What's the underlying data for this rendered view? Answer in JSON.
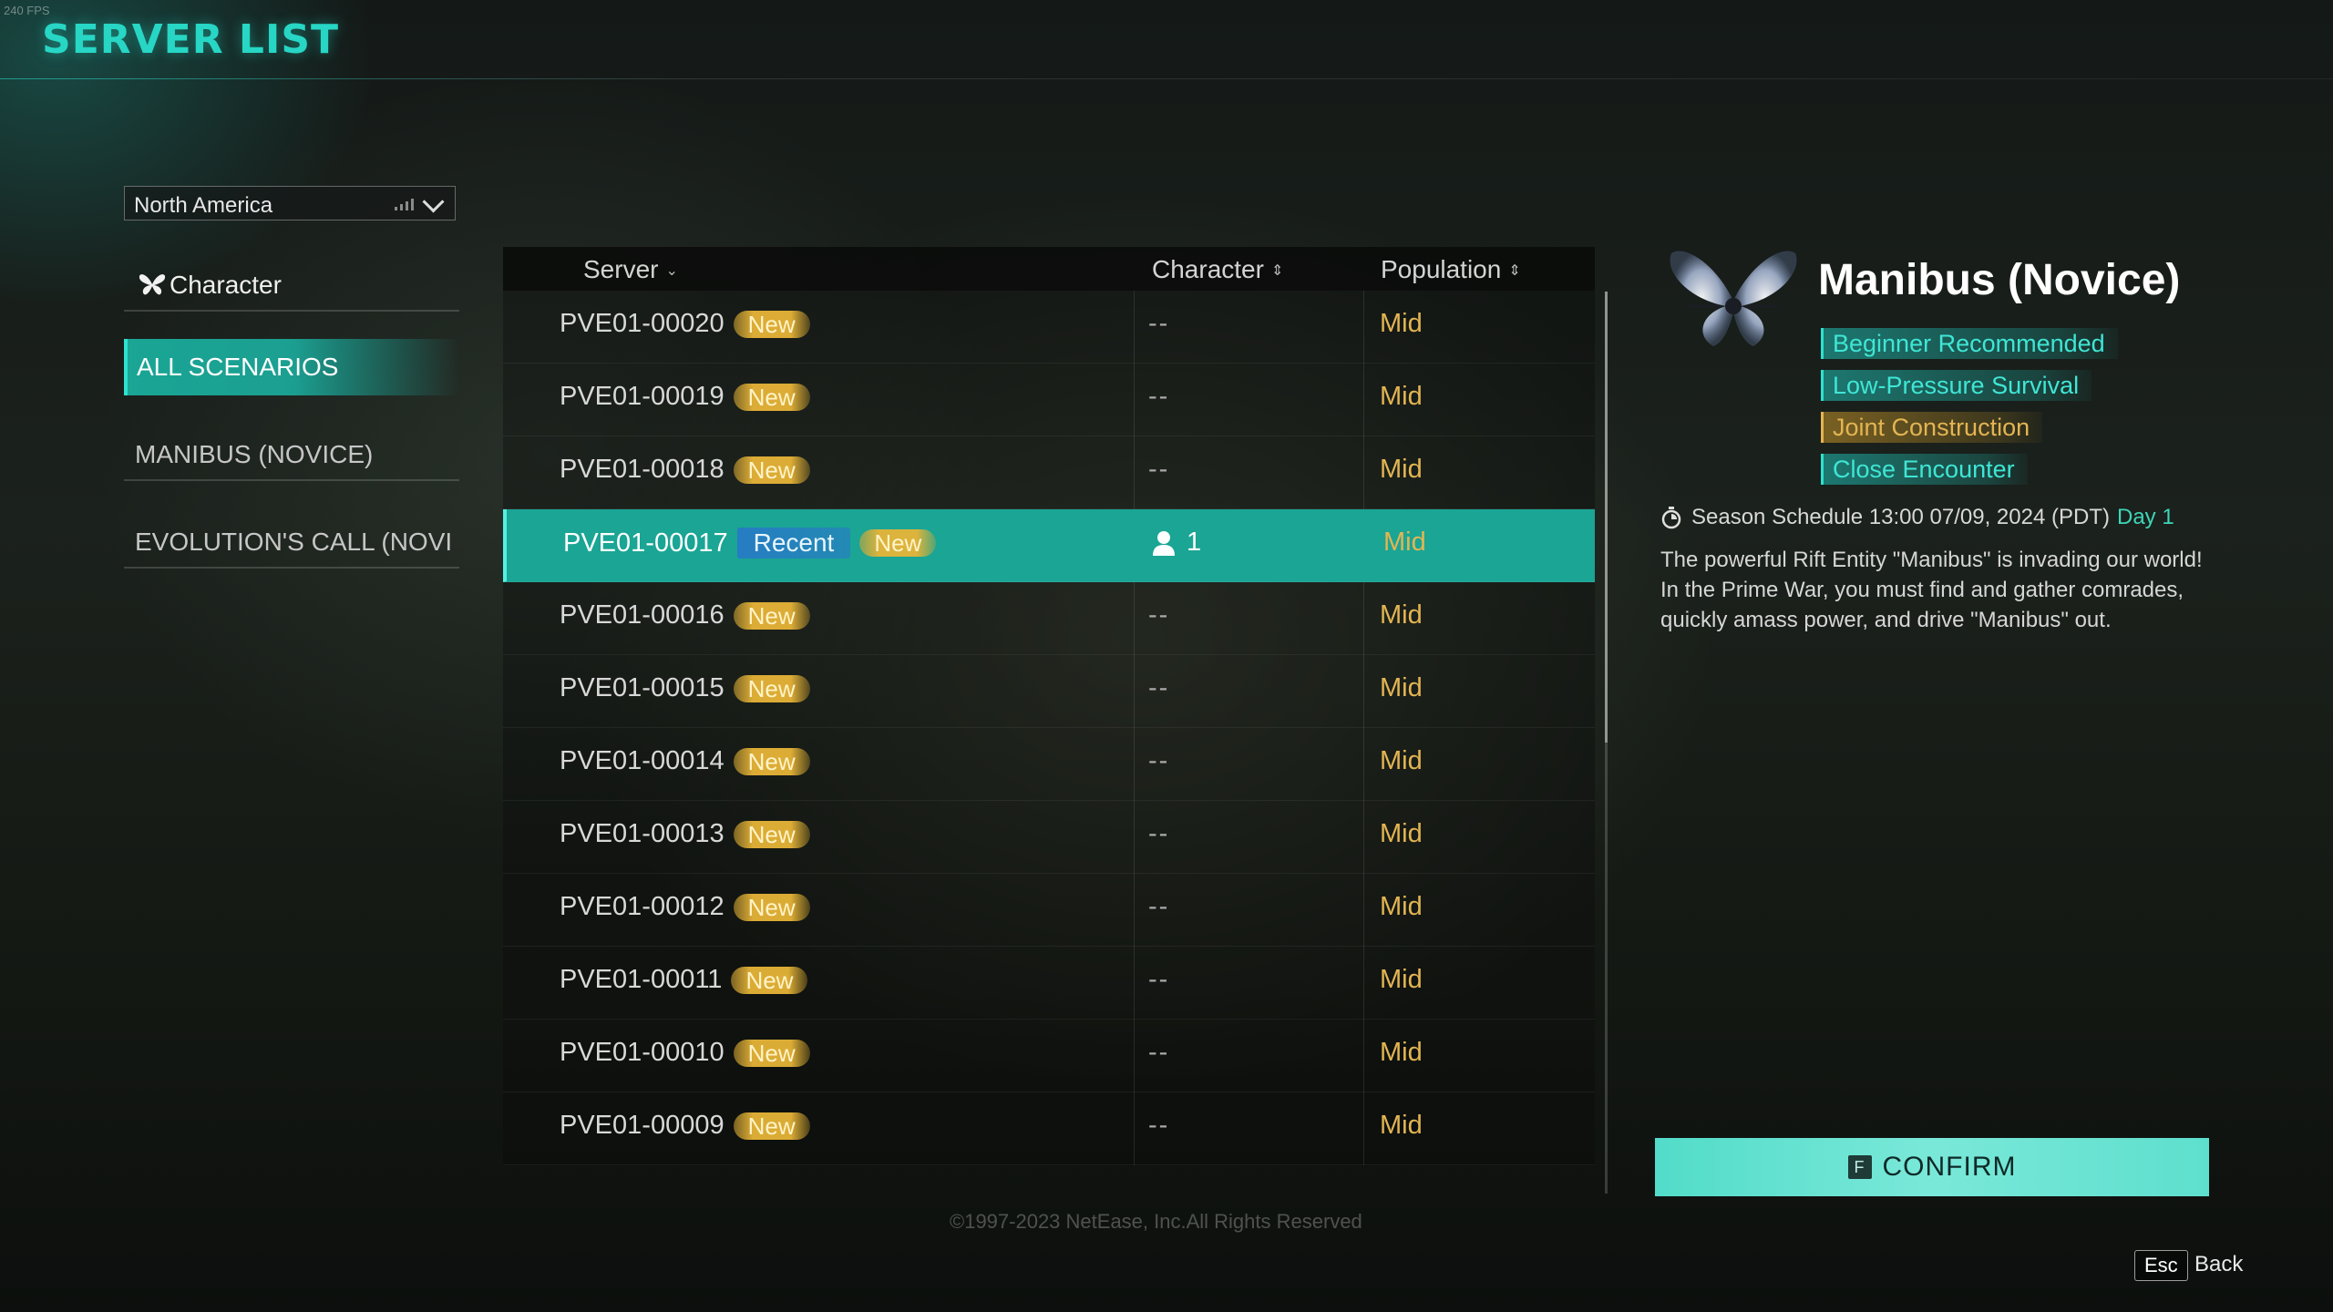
{
  "overlay": {
    "fps": "240 FPS"
  },
  "header": {
    "title": "SERVER LIST"
  },
  "region": {
    "selected": "North America",
    "signal_icon": "signal-bars-icon",
    "dropdown_icon": "chevron-down-icon"
  },
  "nav": {
    "character": {
      "label": "Character",
      "icon": "butterfly-icon"
    },
    "items": [
      {
        "label": "ALL SCENARIOS",
        "active": true
      },
      {
        "label": "MANIBUS (NOVICE)",
        "active": false
      },
      {
        "label": "EVOLUTION'S CALL (NOVI",
        "active": false
      }
    ]
  },
  "table": {
    "columns": [
      "Server",
      "Character",
      "Population"
    ],
    "rows": [
      {
        "server": "PVE01-00020",
        "badges": [
          "New"
        ],
        "character": "--",
        "population": "Mid"
      },
      {
        "server": "PVE01-00019",
        "badges": [
          "New"
        ],
        "character": "--",
        "population": "Mid"
      },
      {
        "server": "PVE01-00018",
        "badges": [
          "New"
        ],
        "character": "--",
        "population": "Mid"
      },
      {
        "server": "PVE01-00017",
        "badges": [
          "Recent",
          "New"
        ],
        "character": "1",
        "population": "Mid",
        "selected": true
      },
      {
        "server": "PVE01-00016",
        "badges": [
          "New"
        ],
        "character": "--",
        "population": "Mid"
      },
      {
        "server": "PVE01-00015",
        "badges": [
          "New"
        ],
        "character": "--",
        "population": "Mid"
      },
      {
        "server": "PVE01-00014",
        "badges": [
          "New"
        ],
        "character": "--",
        "population": "Mid"
      },
      {
        "server": "PVE01-00013",
        "badges": [
          "New"
        ],
        "character": "--",
        "population": "Mid"
      },
      {
        "server": "PVE01-00012",
        "badges": [
          "New"
        ],
        "character": "--",
        "population": "Mid"
      },
      {
        "server": "PVE01-00011",
        "badges": [
          "New"
        ],
        "character": "--",
        "population": "Mid"
      },
      {
        "server": "PVE01-00010",
        "badges": [
          "New"
        ],
        "character": "--",
        "population": "Mid"
      },
      {
        "server": "PVE01-00009",
        "badges": [
          "New"
        ],
        "character": "--",
        "population": "Mid"
      }
    ]
  },
  "footer": {
    "copyright": "©1997-2023 NetEase, Inc.All Rights Reserved"
  },
  "detail": {
    "title": "Manibus (Novice)",
    "emblem_icon": "winged-emblem-icon",
    "tags": [
      {
        "label": "Beginner Recommended",
        "color": "#3fe6d5"
      },
      {
        "label": "Low-Pressure Survival",
        "color": "#3fe6d5"
      },
      {
        "label": "Joint Construction",
        "color": "#e3b552"
      },
      {
        "label": "Close Encounter",
        "color": "#3fe6d5"
      }
    ],
    "schedule": "Season Schedule 13:00 07/09, 2024 (PDT)",
    "schedule_day": "Day 1",
    "description": "The powerful Rift Entity \"Manibus\" is invading our world! In the Prime War, you must find and gather comrades, quickly amass power, and drive \"Manibus\" out."
  },
  "actions": {
    "confirm_key": "F",
    "confirm_label": "CONFIRM",
    "back_key": "Esc",
    "back_label": "Back"
  },
  "colors": {
    "accent": "#1aa595",
    "title": "#27d6c4",
    "population": "#e3b552",
    "new_badge": "#e6b437",
    "recent_badge": "#2878c8"
  }
}
